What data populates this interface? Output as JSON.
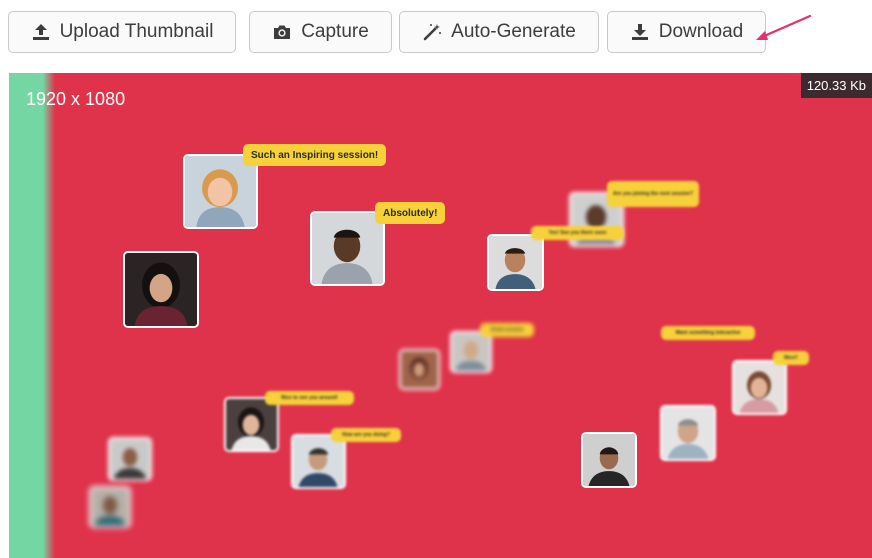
{
  "toolbar": {
    "upload": {
      "label": "Upload Thumbnail",
      "icon": "upload-icon"
    },
    "capture": {
      "label": "Capture",
      "icon": "camera-icon"
    },
    "auto_generate": {
      "label": "Auto-Generate",
      "icon": "magic-wand-icon"
    },
    "download": {
      "label": "Download",
      "icon": "download-icon"
    }
  },
  "preview": {
    "resolution": "1920 x 1080",
    "file_size": "120.33 Kb",
    "background_color": "#df324b",
    "side_color": "#74d7a3",
    "bubbles": {
      "inspiring": "Such an Inspiring session!",
      "absolutely": "Absolutely!",
      "b1": "Are you joining the next session?",
      "b2": "Yes! See you there soon",
      "b3": "Great session",
      "b4": "Want something interactive",
      "b5": "Nice!!",
      "b6": "Nice to see you around!",
      "b7": "How are you doing?"
    }
  },
  "colors": {
    "button_border": "#c9c9c9",
    "bubble": "#f7d13a",
    "arrow": "#e0336f"
  }
}
